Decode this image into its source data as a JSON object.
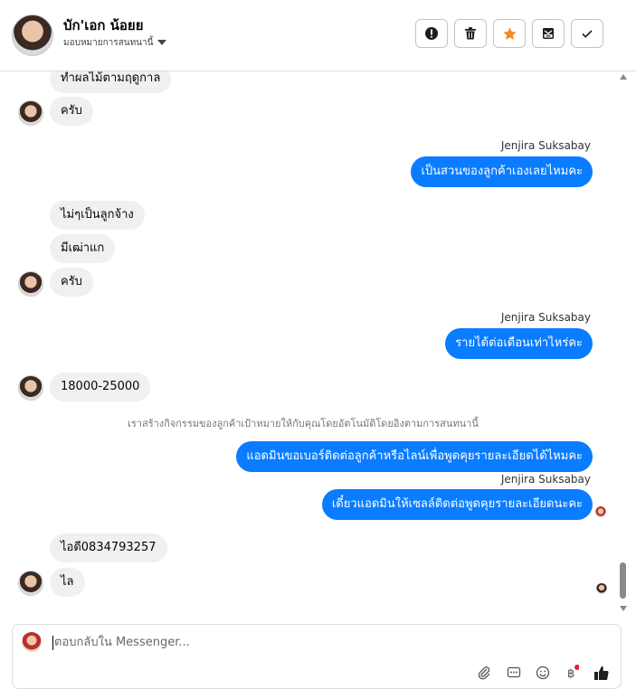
{
  "header": {
    "name": "บัก'เอก น้อยย",
    "subtitle": "มอบหมายการสนทนานี้",
    "actions": [
      "flag-icon",
      "trash-icon",
      "star-icon",
      "inbox-icon",
      "check-icon"
    ],
    "star_color": "#f28c28"
  },
  "messages": {
    "m1": "ทำผลไม้ตามฤดูกาล",
    "m2": "ครับ",
    "sender1": "Jenjira Suksabay",
    "m3": "เป็นสวนของลูกค้าเองเลยไหมคะ",
    "m4": "ไม่ๆเป็นลูกจ้าง",
    "m5": "มีเฒ่าแก",
    "m6": "ครับ",
    "sender2": "Jenjira Suksabay",
    "m7": "รายได้ต่อเดือนเท่าไหร่คะ",
    "m8": "18000-25000",
    "system": "เราสร้างกิจกรรมของลูกค้าเป้าหมายให้กับคุณโดยอัตโนมัติโดยอิงตามการสนทนานี้",
    "m9": "แอดมินขอเบอร์ติดต่อลูกค้าหรือไลน์เพื่อพูดคุยรายละเอียดได้ไหมคะ",
    "sender3": "Jenjira Suksabay",
    "m10": "เดี๋ยวแอดมินให้เซลล์ติดต่อพูดคุยรายละเอียดนะคะ",
    "m11": "ไอดี0834793257",
    "m12": "ไล"
  },
  "composer": {
    "placeholder": "ตอบกลับใน Messenger...",
    "tools": [
      "attach-icon",
      "saved-reply-icon",
      "emoji-icon",
      "payment-icon",
      "like-icon"
    ]
  },
  "colors": {
    "outgoing": "#0a7cff",
    "incoming": "#f0f0f0"
  }
}
